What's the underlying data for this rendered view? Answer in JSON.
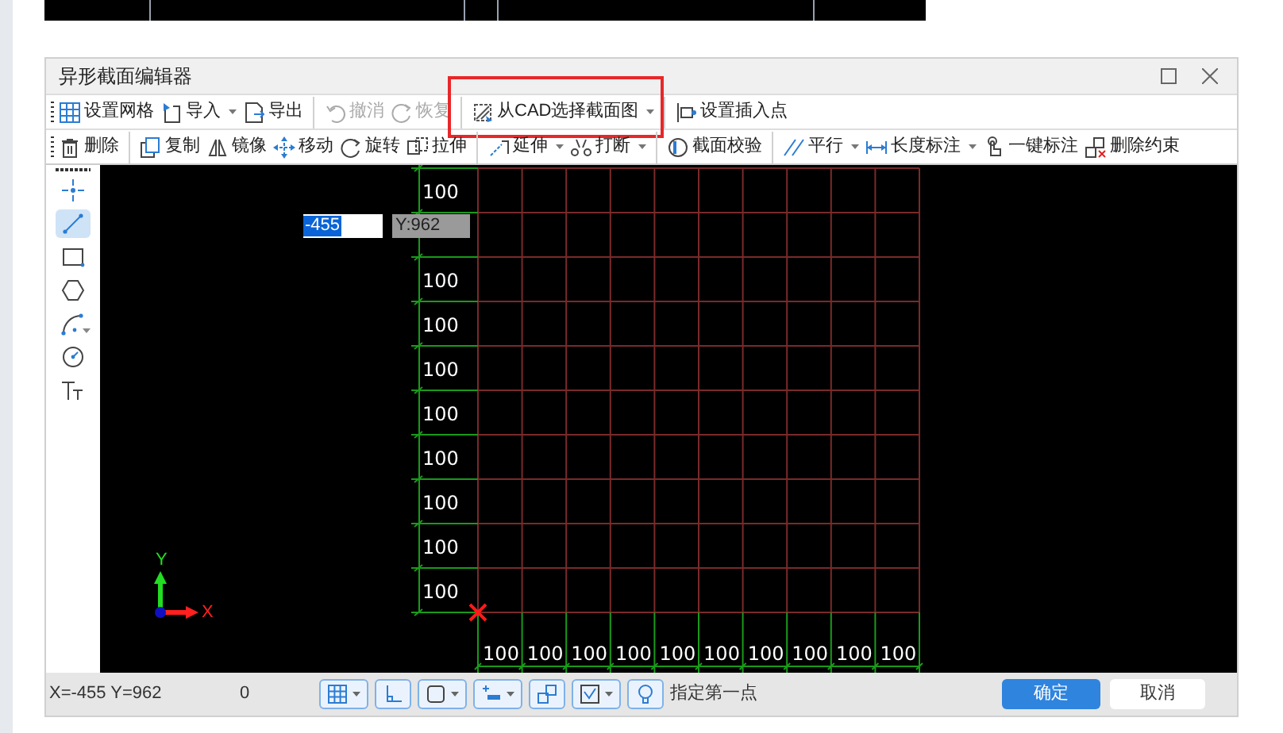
{
  "window": {
    "title": "异形截面编辑器"
  },
  "toolbar_1": [
    {
      "label": "设置网格",
      "disabled": false,
      "dropdown": false,
      "highlighted": false,
      "separator_before": false
    },
    {
      "label": "导入",
      "disabled": false,
      "dropdown": true,
      "highlighted": false,
      "separator_before": false
    },
    {
      "label": "导出",
      "disabled": false,
      "dropdown": false,
      "highlighted": false,
      "separator_before": false
    },
    {
      "label": "撤消",
      "disabled": true,
      "dropdown": false,
      "highlighted": false,
      "separator_before": true
    },
    {
      "label": "恢复",
      "disabled": true,
      "dropdown": false,
      "highlighted": false,
      "separator_before": false
    },
    {
      "label": "从CAD选择截面图",
      "disabled": false,
      "dropdown": true,
      "highlighted": true,
      "separator_before": true
    },
    {
      "label": "设置插入点",
      "disabled": false,
      "dropdown": false,
      "highlighted": false,
      "separator_before": true
    }
  ],
  "toolbar_2": [
    {
      "label": "删除",
      "disabled": false,
      "dropdown": false,
      "separator_before": false
    },
    {
      "label": "复制",
      "disabled": false,
      "dropdown": false,
      "separator_before": true
    },
    {
      "label": "镜像",
      "disabled": false,
      "dropdown": false,
      "separator_before": false
    },
    {
      "label": "移动",
      "disabled": false,
      "dropdown": false,
      "separator_before": false
    },
    {
      "label": "旋转",
      "disabled": false,
      "dropdown": false,
      "separator_before": false
    },
    {
      "label": "拉伸",
      "disabled": false,
      "dropdown": false,
      "separator_before": false
    },
    {
      "label": "延伸",
      "disabled": false,
      "dropdown": true,
      "separator_before": true
    },
    {
      "label": "打断",
      "disabled": false,
      "dropdown": true,
      "separator_before": false
    },
    {
      "label": "截面校验",
      "disabled": false,
      "dropdown": false,
      "separator_before": true
    },
    {
      "label": "平行",
      "disabled": false,
      "dropdown": true,
      "separator_before": true
    },
    {
      "label": "长度标注",
      "disabled": false,
      "dropdown": true,
      "separator_before": false
    },
    {
      "label": "一键标注",
      "disabled": false,
      "dropdown": false,
      "separator_before": false
    },
    {
      "label": "删除约束",
      "disabled": false,
      "dropdown": false,
      "separator_before": false
    }
  ],
  "draw_tools": [
    {
      "selected": false,
      "dropdown": false
    },
    {
      "selected": true,
      "dropdown": false
    },
    {
      "selected": false,
      "dropdown": false
    },
    {
      "selected": false,
      "dropdown": false
    },
    {
      "selected": false,
      "dropdown": true
    },
    {
      "selected": false,
      "dropdown": false
    },
    {
      "selected": false,
      "dropdown": false
    }
  ],
  "canvas": {
    "x_input": "-455",
    "y_input": "Y:962",
    "vertical_dimensions": [
      "100",
      "100",
      "100",
      "100",
      "100",
      "100",
      "100",
      "100",
      "100"
    ],
    "horizontal_dimensions": [
      "100",
      "100",
      "100",
      "100",
      "100",
      "100",
      "100",
      "100",
      "100",
      "100"
    ],
    "axis": {
      "x_label": "X",
      "y_label": "Y"
    }
  },
  "status_bar": {
    "coordinates": "X=-455 Y=962",
    "value": "0",
    "tools": [
      {
        "dropdown": true
      },
      {
        "dropdown": false
      },
      {
        "dropdown": true
      },
      {
        "dropdown": true
      },
      {
        "dropdown": false
      },
      {
        "dropdown": true
      },
      {
        "dropdown": false
      }
    ],
    "prompt": "指定第一点",
    "ok": "确定",
    "cancel": "取消"
  }
}
